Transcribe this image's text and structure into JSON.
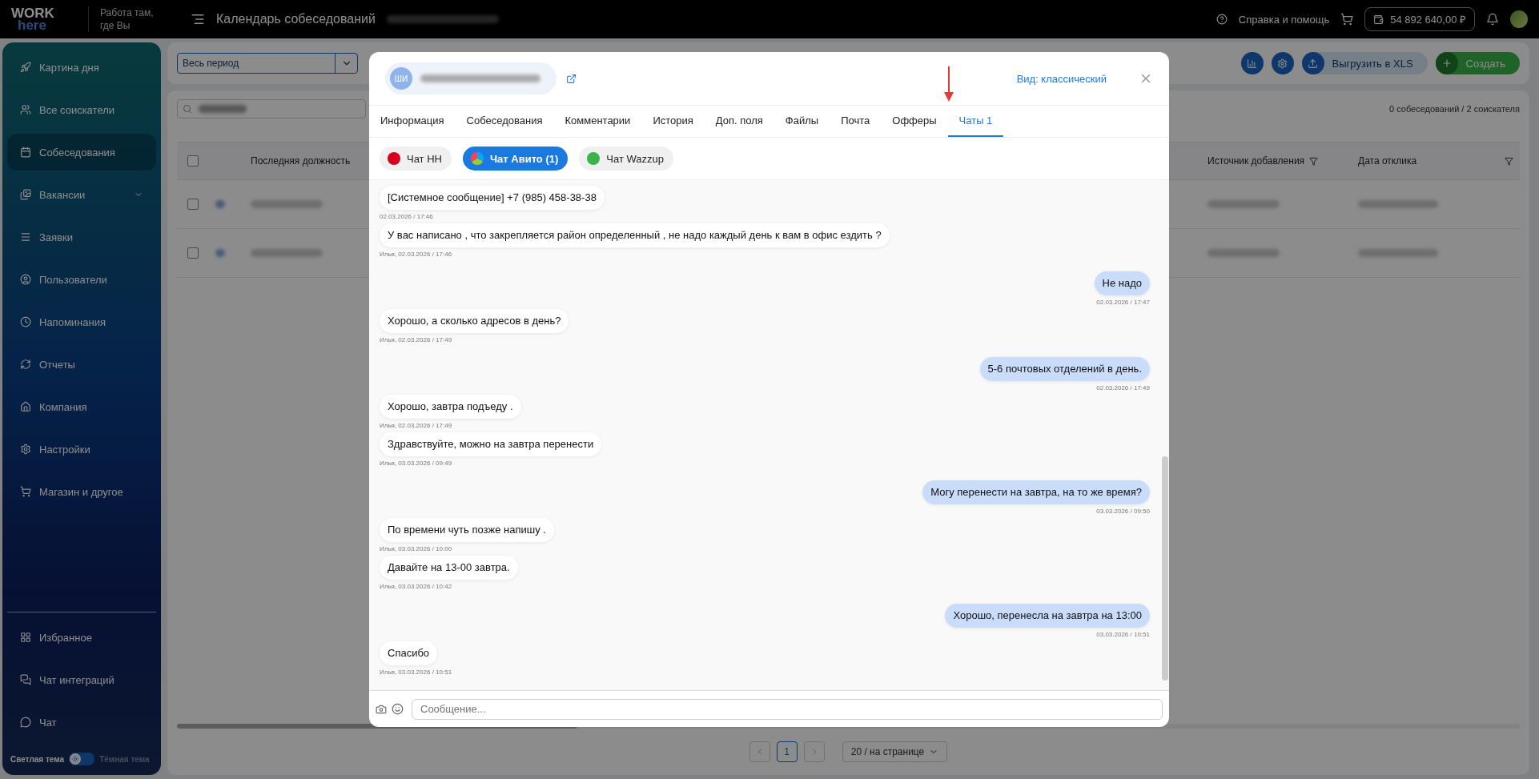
{
  "topbar": {
    "logo_top": "WORK",
    "logo_bottom": "here",
    "slogan": "Работа там, где Вы",
    "title": "Календарь собеседований",
    "help": "Справка и помощь",
    "balance": "54 892 640,00 ₽"
  },
  "sidebar": {
    "items": [
      {
        "label": "Картина дня",
        "kind": "link",
        "selected": false
      },
      {
        "label": "Все соискатели",
        "kind": "link",
        "selected": false
      },
      {
        "label": "Собеседования",
        "kind": "link",
        "selected": true
      },
      {
        "label": "Вакансии",
        "kind": "group",
        "selected": false
      },
      {
        "label": "Заявки",
        "kind": "link",
        "selected": false
      },
      {
        "label": "Пользователи",
        "kind": "link",
        "selected": false
      },
      {
        "label": "Напоминания",
        "kind": "link",
        "selected": false
      },
      {
        "label": "Отчеты",
        "kind": "link",
        "selected": false
      },
      {
        "label": "Компания",
        "kind": "link",
        "selected": false
      },
      {
        "label": "Настройки",
        "kind": "link",
        "selected": false
      },
      {
        "label": "Магазин и другое",
        "kind": "link",
        "selected": false
      }
    ],
    "bottom_items": [
      {
        "label": "Избранное"
      },
      {
        "label": "Чат интеграций"
      },
      {
        "label": "Чат"
      }
    ],
    "theme": {
      "light_label": "Светлая тема",
      "dark_label": "Тёмная тема",
      "dark": false
    }
  },
  "filters": {
    "period": "Весь период",
    "export": "Выгрузить в XLS",
    "create": "Создать"
  },
  "summary": "0 собеседований / 2 соискателя",
  "table": {
    "all_checked": false,
    "columns": [
      {
        "label": "Последняя должность"
      },
      {
        "label": "Источник добавления"
      },
      {
        "label": "Дата отклика"
      }
    ],
    "rows": [
      {
        "checked": false
      },
      {
        "checked": false
      }
    ]
  },
  "pagination": {
    "pages": [
      {
        "label": "1",
        "selected": true
      }
    ],
    "page_size": "20 / на странице"
  },
  "modal": {
    "avatar": "ШИ",
    "view": "Вид: классический",
    "tabs": [
      {
        "label": "Информация",
        "selected": false
      },
      {
        "label": "Собеседования",
        "selected": false
      },
      {
        "label": "Комментарии",
        "selected": false
      },
      {
        "label": "История",
        "selected": false
      },
      {
        "label": "Доп. поля",
        "selected": false
      },
      {
        "label": "Файлы",
        "selected": false
      },
      {
        "label": "Почта",
        "selected": false
      },
      {
        "label": "Офферы",
        "selected": false
      },
      {
        "label": "Чаты 1",
        "selected": true
      }
    ],
    "chat_tabs": [
      {
        "label": "Чат HH",
        "kind": "hh",
        "selected": false
      },
      {
        "label": "Чат Авито (1)",
        "kind": "avito",
        "selected": true
      },
      {
        "label": "Чат Wazzup",
        "kind": "wazzup",
        "selected": false
      }
    ],
    "messages": [
      {
        "kind": "incoming",
        "text": "[Системное сообщение] +7 (985) 458-38-38",
        "meta": "02.03.2026 / 17:46"
      },
      {
        "kind": "incoming",
        "text": "У вас написано , что закрепляется район определенный , не надо каждый день к вам в офис ездить ?",
        "meta": "Илья, 02.03.2026 / 17:46"
      },
      {
        "kind": "outgoing",
        "text": "Не надо",
        "meta": "02.03.2026 / 17:47"
      },
      {
        "kind": "incoming",
        "text": "Хорошо, а сколько адресов в день?",
        "meta": "Илья, 02.03.2026 / 17:49"
      },
      {
        "kind": "outgoing",
        "text": "5-6 почтовых отделений в день.",
        "meta": "02.03.2026 / 17:49"
      },
      {
        "kind": "incoming",
        "text": "Хорошо, завтра подъеду .",
        "meta": "Илья, 02.03.2026 / 17:49"
      },
      {
        "kind": "incoming",
        "text": "Здравствуйте, можно на завтра перенести",
        "meta": "Илья, 03.03.2026 / 09:49"
      },
      {
        "kind": "outgoing",
        "text": "Могу перенести на завтра, на то же время?",
        "meta": "03.03.2026 / 09:50"
      },
      {
        "kind": "incoming",
        "text": "По времени чуть позже напишу .",
        "meta": "Илья, 03.03.2026 / 10:00"
      },
      {
        "kind": "incoming",
        "text": "Давайте на 13-00 завтра.",
        "meta": "Илья, 03.03.2026 / 10:42"
      },
      {
        "kind": "outgoing",
        "text": "Хорошо, перенесла на завтра на 13:00",
        "meta": "03.03.2026 / 10:51"
      },
      {
        "kind": "incoming",
        "text": "Спасибо",
        "meta": "Илья, 03.03.2026 / 10:51"
      }
    ],
    "input": {
      "placeholder": "Сообщение..."
    }
  }
}
